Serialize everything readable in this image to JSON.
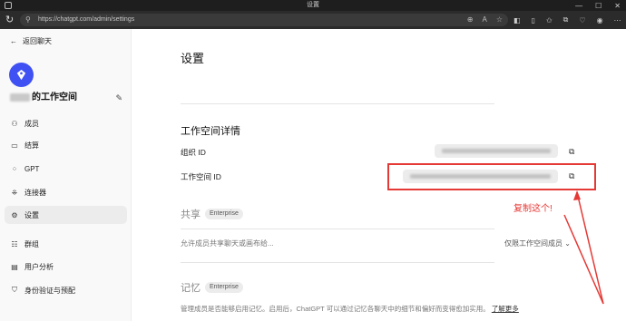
{
  "browser": {
    "window_title": "设置",
    "url": "https://chatgpt.com/admin/settings"
  },
  "sidebar": {
    "back_label": "返回聊天",
    "workspace_name": "的工作空间",
    "items": [
      {
        "label": "成员",
        "icon": "users-icon"
      },
      {
        "label": "结算",
        "icon": "card-icon"
      },
      {
        "label": "GPT",
        "icon": "grid-icon"
      },
      {
        "label": "连接器",
        "icon": "connector-icon"
      },
      {
        "label": "设置",
        "icon": "gear-icon",
        "active": true
      },
      {
        "label": "群组",
        "icon": "group-icon"
      },
      {
        "label": "用户分析",
        "icon": "analytics-icon"
      },
      {
        "label": "身份验证与预配",
        "icon": "shield-icon"
      }
    ]
  },
  "main": {
    "title": "设置",
    "details": {
      "heading": "工作空间详情",
      "org_id_label": "组织 ID",
      "workspace_id_label": "工作空间 ID"
    },
    "sharing": {
      "heading": "共享",
      "badge": "Enterprise",
      "description": "允许成员共享聊天或画布给...",
      "dropdown_value": "仅限工作空间成员"
    },
    "memory": {
      "heading": "记忆",
      "badge": "Enterprise",
      "description": "管理成员是否能够启用记忆。启用后，ChatGPT 可以通过记忆各聊天中的细节和偏好而变得愈加实用。",
      "learn_more": "了解更多"
    }
  },
  "annotation": {
    "text": "复制这个!",
    "color": "#e53935"
  },
  "colors": {
    "logo": "#3f51f3",
    "chrome_dark": "#1e1e1e"
  }
}
